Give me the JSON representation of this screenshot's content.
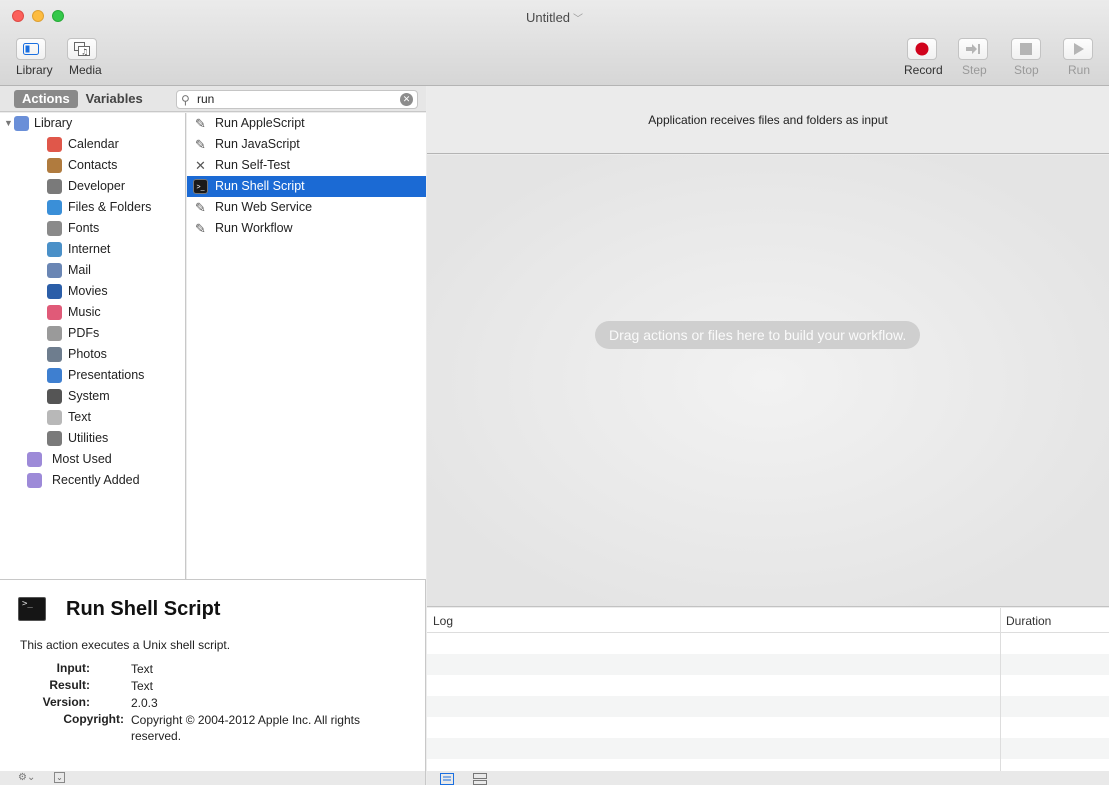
{
  "window": {
    "title": "Untitled"
  },
  "toolbar": {
    "left": [
      {
        "name": "library",
        "label": "Library",
        "icon": "sidebar-icon"
      },
      {
        "name": "media",
        "label": "Media",
        "icon": "media-icon"
      }
    ],
    "right": [
      {
        "name": "record",
        "label": "Record",
        "icon": "record-icon",
        "enabled": true
      },
      {
        "name": "step",
        "label": "Step",
        "icon": "step-icon",
        "enabled": false
      },
      {
        "name": "stop",
        "label": "Stop",
        "icon": "stop-icon",
        "enabled": false
      },
      {
        "name": "run",
        "label": "Run",
        "icon": "play-icon",
        "enabled": false
      }
    ]
  },
  "library_header": {
    "tabs": {
      "actions": "Actions",
      "variables": "Variables"
    },
    "search_value": "run"
  },
  "categories": [
    {
      "label": "Library",
      "icon": "library-icon",
      "color": "#6a8fd8",
      "level": 0
    },
    {
      "label": "Calendar",
      "icon": "calendar-icon",
      "color": "#e0574a",
      "level": 1
    },
    {
      "label": "Contacts",
      "icon": "contacts-icon",
      "color": "#b07b3e",
      "level": 1
    },
    {
      "label": "Developer",
      "icon": "tools-icon",
      "color": "#7a7a7a",
      "level": 1
    },
    {
      "label": "Files & Folders",
      "icon": "folder-icon",
      "color": "#3a8fd8",
      "level": 1
    },
    {
      "label": "Fonts",
      "icon": "fonts-icon",
      "color": "#8a8a8a",
      "level": 1
    },
    {
      "label": "Internet",
      "icon": "globe-icon",
      "color": "#4a90c8",
      "level": 1
    },
    {
      "label": "Mail",
      "icon": "mail-icon",
      "color": "#6a86b4",
      "level": 1
    },
    {
      "label": "Movies",
      "icon": "movies-icon",
      "color": "#2b5ea8",
      "level": 1
    },
    {
      "label": "Music",
      "icon": "music-icon",
      "color": "#e05a78",
      "level": 1
    },
    {
      "label": "PDFs",
      "icon": "pdf-icon",
      "color": "#9a9a9a",
      "level": 1
    },
    {
      "label": "Photos",
      "icon": "photos-icon",
      "color": "#6e7d8e",
      "level": 1
    },
    {
      "label": "Presentations",
      "icon": "presentation-icon",
      "color": "#3e7fd0",
      "level": 1
    },
    {
      "label": "System",
      "icon": "system-icon",
      "color": "#555555",
      "level": 1
    },
    {
      "label": "Text",
      "icon": "text-icon",
      "color": "#b8b8b8",
      "level": 1
    },
    {
      "label": "Utilities",
      "icon": "tools-icon",
      "color": "#7a7a7a",
      "level": 1
    },
    {
      "label": "Most Used",
      "icon": "smart-folder-icon",
      "color": "#9d8ad8",
      "level": 0
    },
    {
      "label": "Recently Added",
      "icon": "smart-folder-icon",
      "color": "#9d8ad8",
      "level": 0
    }
  ],
  "actions": [
    {
      "label": "Run AppleScript",
      "icon": "script-icon",
      "selected": false
    },
    {
      "label": "Run JavaScript",
      "icon": "script-icon",
      "selected": false
    },
    {
      "label": "Run Self-Test",
      "icon": "tools-icon",
      "selected": false
    },
    {
      "label": "Run Shell Script",
      "icon": "terminal-icon",
      "selected": true
    },
    {
      "label": "Run Web Service",
      "icon": "script-icon",
      "selected": false
    },
    {
      "label": "Run Workflow",
      "icon": "script-icon",
      "selected": false
    }
  ],
  "description": {
    "title": "Run Shell Script",
    "summary": "This action executes a Unix shell script.",
    "input_key": "Input:",
    "input": "Text",
    "result_key": "Result:",
    "result": "Text",
    "version_key": "Version:",
    "version": "2.0.3",
    "copyright_key": "Copyright:",
    "copyright": "Copyright © 2004-2012 Apple Inc.  All rights reserved."
  },
  "workflow": {
    "input_note": "Application receives files and folders as input",
    "placeholder": "Drag actions or files here to build your workflow."
  },
  "log": {
    "col_log": "Log",
    "col_duration": "Duration"
  },
  "colors": {
    "selection": "#1b6ad4",
    "record": "#d0021b"
  }
}
